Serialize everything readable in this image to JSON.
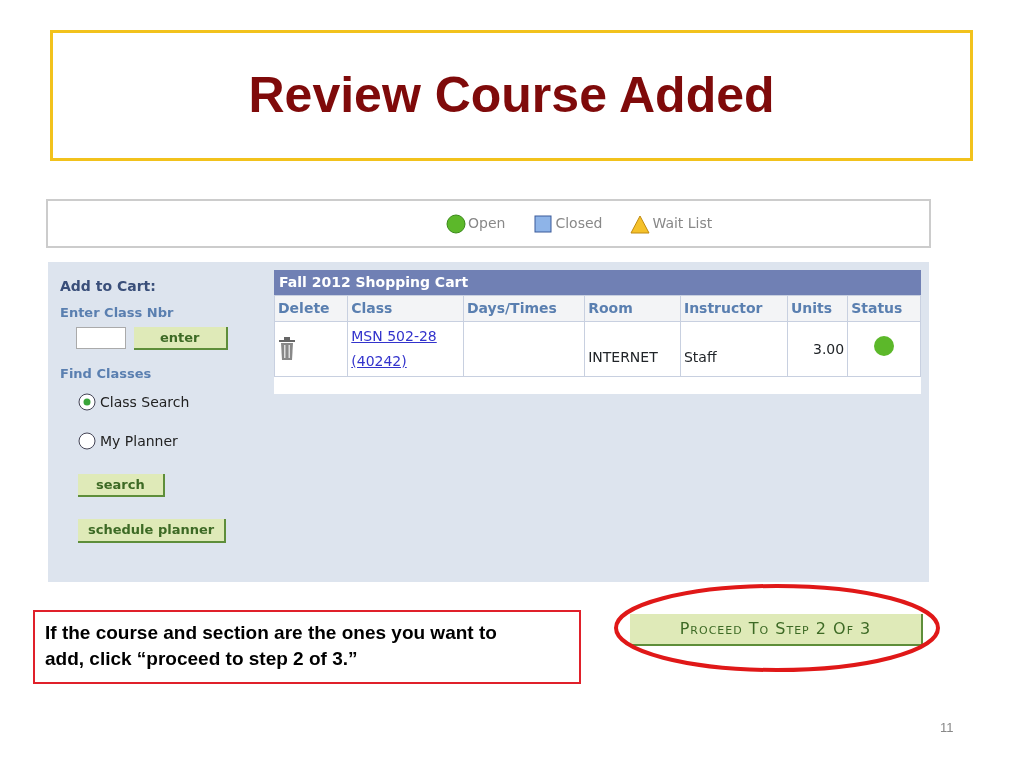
{
  "slide_title": "Review Course Added",
  "legend": [
    {
      "kind": "circle",
      "label": "Open",
      "color": "#5cb82a"
    },
    {
      "kind": "square",
      "label": "Closed",
      "color": "#8eb4e8"
    },
    {
      "kind": "triangle",
      "label": "Wait List",
      "color": "#f5c12a"
    }
  ],
  "add_to_cart": {
    "heading": "Add to Cart:",
    "class_nbr_label": "Enter Class Nbr",
    "enter_button": "enter",
    "find_heading": "Find Classes",
    "options": [
      {
        "label": "Class Search",
        "selected": true
      },
      {
        "label": "My Planner",
        "selected": false
      }
    ],
    "buttons": [
      "search",
      "schedule planner"
    ]
  },
  "cart": {
    "title": "Fall 2012 Shopping Cart",
    "columns": [
      "Delete",
      "Class",
      "Days/Times",
      "Room",
      "Instructor",
      "Units",
      "Status"
    ],
    "rows": [
      {
        "class_lines": [
          "MSN 502-28",
          "(40242)"
        ],
        "room": "INTERNET",
        "instructor": "Staff",
        "units": "3.00",
        "color": "#5cb82a"
      }
    ]
  },
  "callout": "If the course and section are the ones you want to add, click “proceed to step 2 of 3.”",
  "proceed_button": "Proceed To Step 2 Of 3",
  "page_number": "11"
}
